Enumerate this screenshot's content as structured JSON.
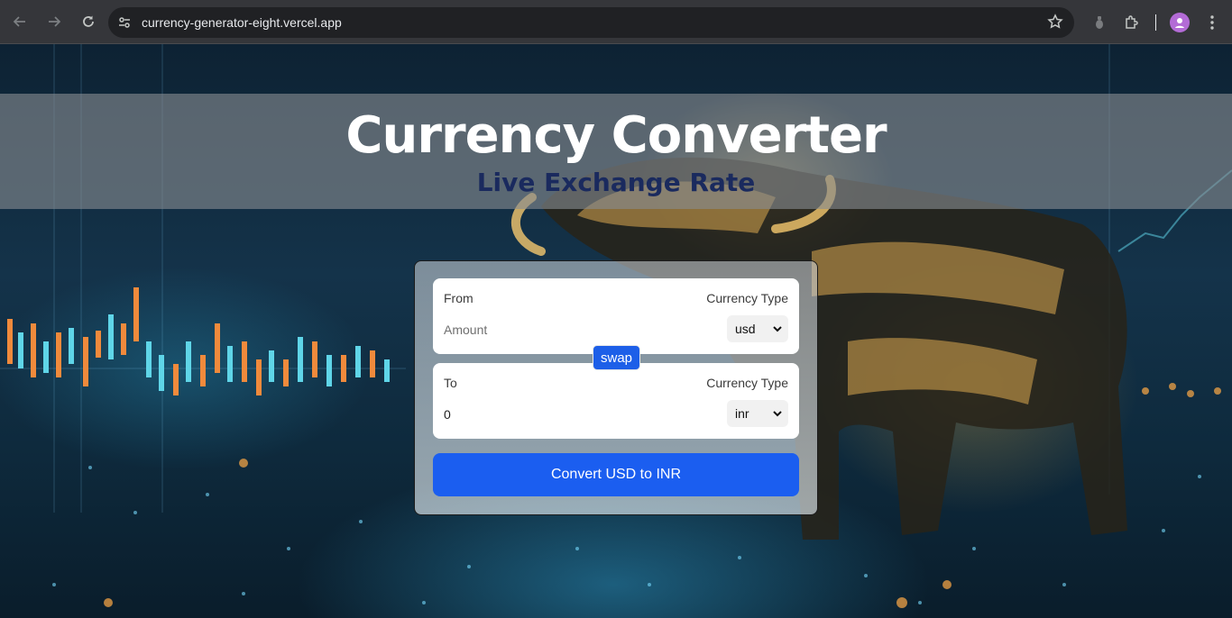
{
  "browser": {
    "url": "currency-generator-eight.vercel.app"
  },
  "page": {
    "title": "Currency Converter",
    "subtitle": "Live Exchange Rate"
  },
  "converter": {
    "from": {
      "label": "From",
      "type_label": "Currency Type",
      "amount_placeholder": "Amount",
      "amount_value": "",
      "currency": "usd"
    },
    "to": {
      "label": "To",
      "type_label": "Currency Type",
      "amount_value": "0",
      "currency": "inr"
    },
    "swap_label": "swap",
    "convert_label": "Convert USD to INR"
  },
  "colors": {
    "accent": "#1b5ef0",
    "subtitle": "#1a2a5e"
  }
}
